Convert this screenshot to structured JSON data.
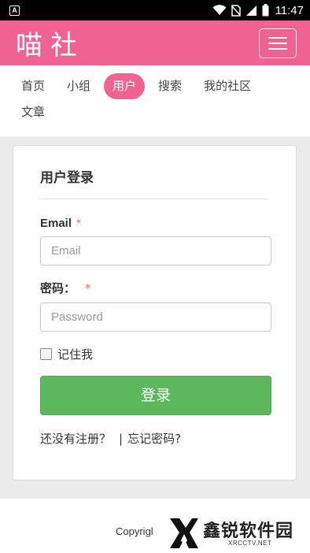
{
  "status_bar": {
    "app_icon_letter": "A",
    "time": "11:47"
  },
  "header": {
    "brand": "喵社"
  },
  "nav": {
    "items": [
      {
        "label": "首页"
      },
      {
        "label": "小组"
      },
      {
        "label": "用户",
        "active": true
      },
      {
        "label": "搜索"
      },
      {
        "label": "我的社区"
      },
      {
        "label": "文章"
      }
    ]
  },
  "login": {
    "title": "用户登录",
    "email_label": "Email",
    "email_required": "*",
    "email_placeholder": "Email",
    "email_value": "",
    "password_label": "密码：",
    "password_required": "*",
    "password_placeholder": "Password",
    "password_value": "",
    "remember_label": "记住我",
    "remember_checked": false,
    "submit_label": "登录",
    "register_link": "还没有注册？",
    "separator": "|",
    "forgot_link": "忘记密码?"
  },
  "footer": {
    "copyright": "Copyrigl"
  },
  "watermark": {
    "name": "鑫锐软件园",
    "url": "XRCCTV.NET"
  },
  "colors": {
    "brand_pink": "#f06292",
    "submit_green": "#5cb85c",
    "required_orange": "#e8735a"
  }
}
